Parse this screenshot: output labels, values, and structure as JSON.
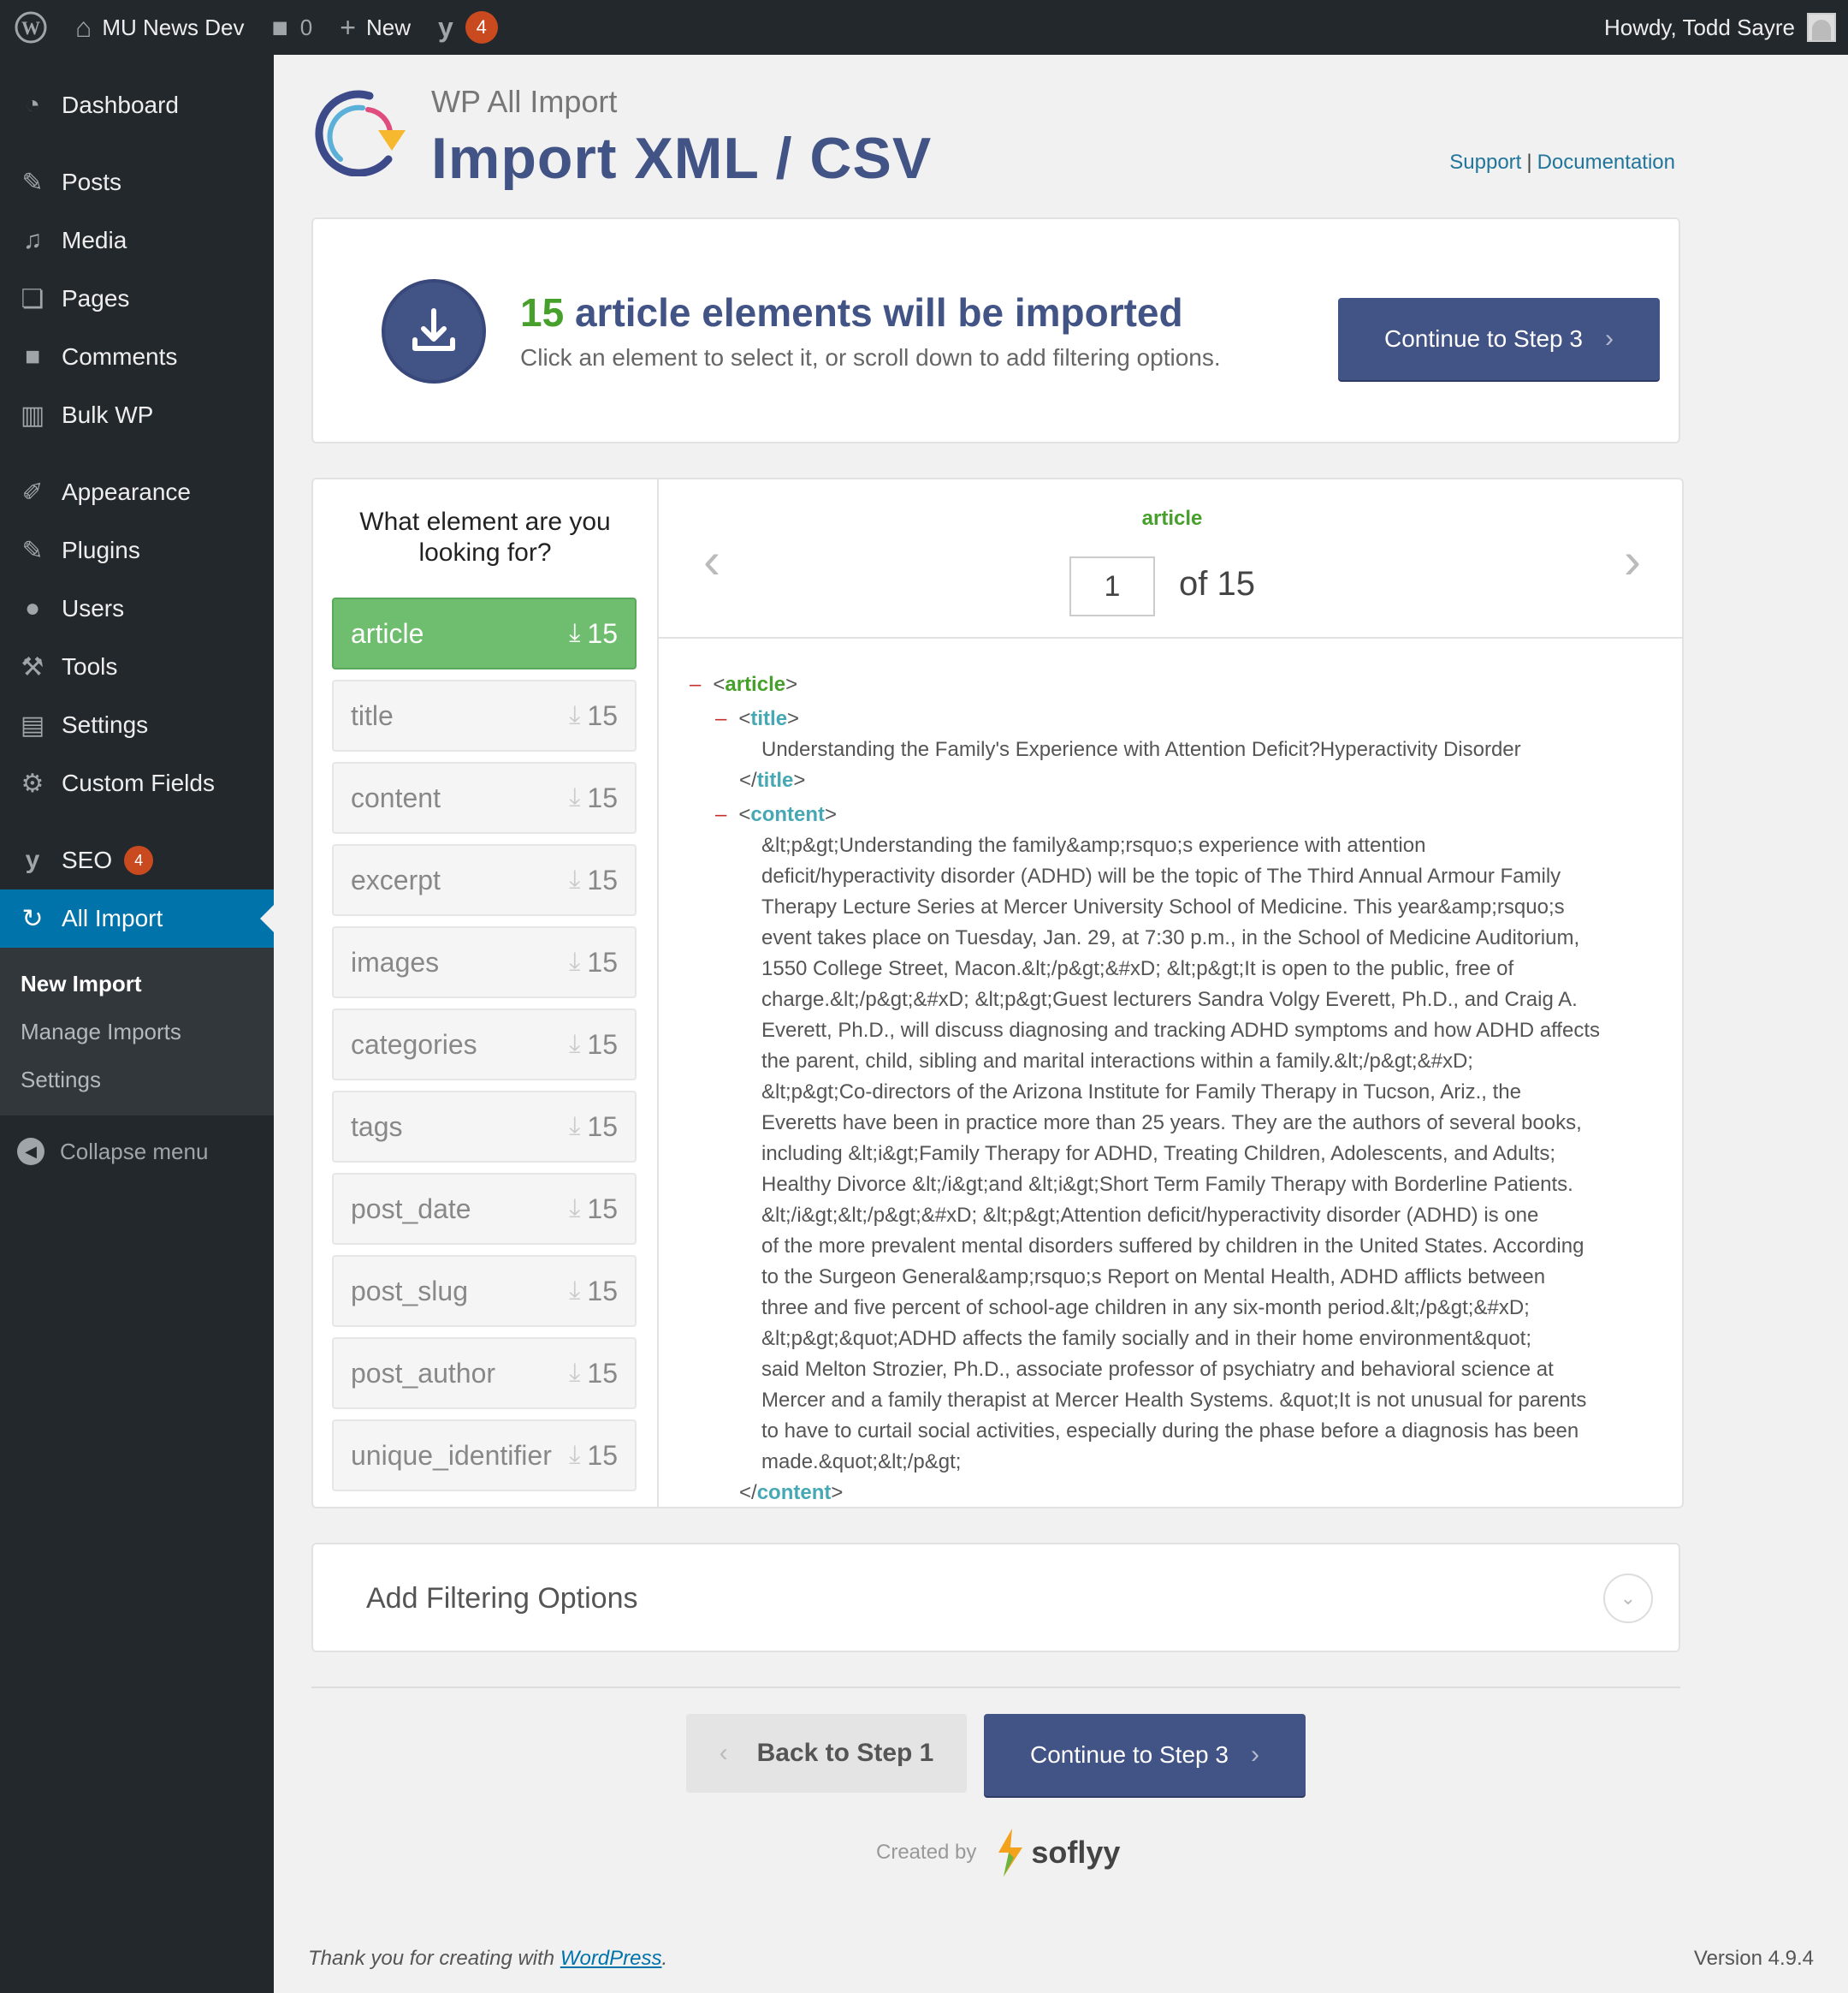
{
  "adminbar": {
    "site_name": "MU News Dev",
    "comments_count": "0",
    "new_label": "New",
    "seo_count": "4",
    "howdy": "Howdy, Todd Sayre"
  },
  "sidebar": {
    "items": [
      {
        "label": "Dashboard",
        "icon": "dashboard-icon"
      },
      {
        "label": "Posts",
        "icon": "pin-icon"
      },
      {
        "label": "Media",
        "icon": "media-icon"
      },
      {
        "label": "Pages",
        "icon": "pages-icon"
      },
      {
        "label": "Comments",
        "icon": "comment-icon"
      },
      {
        "label": "Bulk WP",
        "icon": "trash-icon"
      },
      {
        "label": "Appearance",
        "icon": "brush-icon"
      },
      {
        "label": "Plugins",
        "icon": "plug-icon"
      },
      {
        "label": "Users",
        "icon": "user-icon"
      },
      {
        "label": "Tools",
        "icon": "wrench-icon"
      },
      {
        "label": "Settings",
        "icon": "sliders-icon"
      },
      {
        "label": "Custom Fields",
        "icon": "gear-icon"
      },
      {
        "label": "SEO",
        "icon": "yoast-icon",
        "badge": "4"
      },
      {
        "label": "All Import",
        "icon": "all-import-icon"
      }
    ],
    "submenu": [
      "New Import",
      "Manage Imports",
      "Settings"
    ],
    "collapse_label": "Collapse menu"
  },
  "header": {
    "brand": "WP All Import",
    "title": "Import XML / CSV",
    "support_link": "Support",
    "documentation_link": "Documentation"
  },
  "summary": {
    "count": "15",
    "headline_rest": "article elements will be imported",
    "hint": "Click an element to select it, or scroll down to add filtering options.",
    "continue_label": "Continue to Step 3"
  },
  "element_list": {
    "question": "What element are you looking for?",
    "items": [
      {
        "name": "article",
        "count": "15"
      },
      {
        "name": "title",
        "count": "15"
      },
      {
        "name": "content",
        "count": "15"
      },
      {
        "name": "excerpt",
        "count": "15"
      },
      {
        "name": "images",
        "count": "15"
      },
      {
        "name": "categories",
        "count": "15"
      },
      {
        "name": "tags",
        "count": "15"
      },
      {
        "name": "post_date",
        "count": "15"
      },
      {
        "name": "post_slug",
        "count": "15"
      },
      {
        "name": "post_author",
        "count": "15"
      },
      {
        "name": "unique_identifier",
        "count": "15"
      }
    ]
  },
  "xml_viewer": {
    "element_tag": "article",
    "page_value": "1",
    "of_total": "of 15",
    "collapse_marker": "–",
    "tags": {
      "article": "article",
      "title": "title",
      "content": "content"
    },
    "title_text": "Understanding the Family's Experience with Attention Deficit?Hyperactivity Disorder",
    "content_lines": [
      "&lt;p&gt;Understanding the family&amp;rsquo;s experience with attention",
      "deficit/hyperactivity disorder (ADHD) will be the topic of The Third Annual Armour Family",
      "Therapy Lecture Series at Mercer University School of Medicine. This year&amp;rsquo;s",
      "event takes place on Tuesday, Jan. 29, at 7:30 p.m., in the School of Medicine Auditorium,",
      "1550 College Street, Macon.&lt;/p&gt;&#xD; &lt;p&gt;It is open to the public, free of",
      "charge.&lt;/p&gt;&#xD; &lt;p&gt;Guest lecturers Sandra Volgy Everett, Ph.D., and Craig A.",
      "Everett, Ph.D., will discuss diagnosing and tracking ADHD symptoms and how ADHD affects",
      "the parent, child, sibling and marital interactions within a family.&lt;/p&gt;&#xD;",
      "&lt;p&gt;Co-directors of the Arizona Institute for Family Therapy in Tucson, Ariz., the",
      "Everetts have been in practice more than 25 years. They are the authors of several books,",
      "including &lt;i&gt;Family Therapy for ADHD, Treating Children, Adolescents, and Adults;",
      "Healthy Divorce &lt;/i&gt;and &lt;i&gt;Short Term Family Therapy with Borderline Patients.",
      "&lt;/i&gt;&lt;/p&gt;&#xD; &lt;p&gt;Attention deficit/hyperactivity disorder (ADHD) is one",
      "of the more prevalent mental disorders suffered by children in the United States. According",
      "to the Surgeon General&amp;rsquo;s Report on Mental Health, ADHD afflicts between",
      "three and five percent of school-age children in any six-month period.&lt;/p&gt;&#xD;",
      "&lt;p&gt;&quot;ADHD affects the family socially and in their home environment&quot;",
      "said Melton Strozier, Ph.D., associate professor of psychiatry and behavioral science at",
      "Mercer and a family therapist at Mercer Health Systems. &quot;It is not unusual for parents",
      "to have to curtail social activities, especially during the phase before a diagnosis has been",
      "made.&quot;&lt;/p&gt;"
    ]
  },
  "filtering": {
    "label": "Add Filtering Options"
  },
  "nav_buttons": {
    "back_label": "Back to Step 1",
    "continue_label": "Continue to Step 3"
  },
  "credits": {
    "created_by": "Created by",
    "brand": "soflyy"
  },
  "footer": {
    "thanks_prefix": "Thank you for creating with ",
    "wordpress_link": "WordPress",
    "thanks_suffix": ".",
    "version": "Version 4.9.4"
  },
  "colors": {
    "primary": "#425385",
    "success": "#46a02b",
    "admin_dark": "#23282d",
    "wp_blue": "#0073aa",
    "badge": "#ca4a1f"
  }
}
